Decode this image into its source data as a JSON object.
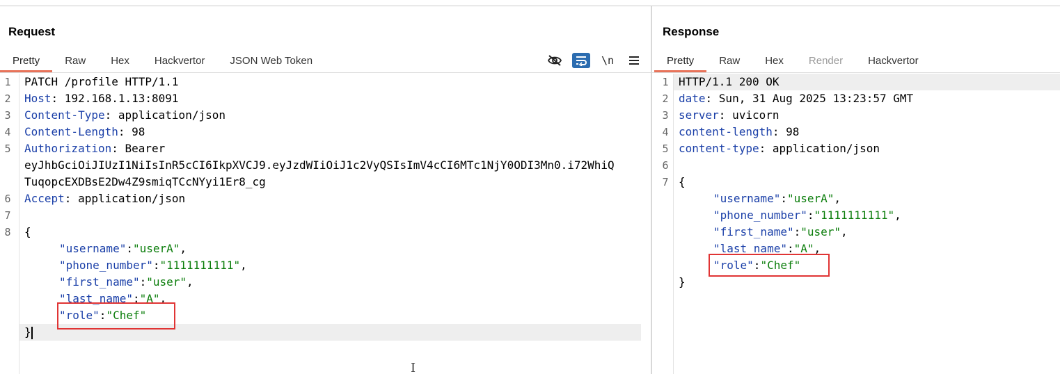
{
  "request": {
    "title": "Request",
    "tabs": [
      "Pretty",
      "Raw",
      "Hex",
      "Hackvertor",
      "JSON Web Token"
    ],
    "toolbar": {
      "hide_icon": "eye-off-icon",
      "wrap_icon": "wrap-lines-icon",
      "newline_label": "\\n",
      "menu_icon": "hamburger-menu-icon"
    },
    "lines": {
      "l1": "PATCH /profile HTTP/1.1",
      "l2k": "Host",
      "l2v": ": 192.168.1.13:8091",
      "l3k": "Content-Type",
      "l3v": ": application/json",
      "l4k": "Content-Length",
      "l4v": ": 98",
      "l5k": "Authorization",
      "l5v": ": Bearer",
      "l5w1": "eyJhbGciOiJIUzI1NiIsInR5cCI6IkpXVCJ9.eyJzdWIiOiJ1c2VyQSIsImV4cCI6MTc1NjY0ODI3Mn0.i72WhiQ",
      "l5w2": "TuqopcEXDBsE2Dw4Z9smiqTCcNYyi1Er8_cg",
      "l6k": "Accept",
      "l6v": ": application/json",
      "l8": "{",
      "f1k": "\"username\"",
      "f1v": "\"userA\"",
      "f2k": "\"phone_number\"",
      "f2v": "\"1111111111\"",
      "f3k": "\"first_name\"",
      "f3v": "\"user\"",
      "f4k": "\"last_name\"",
      "f4v": "\"A\"",
      "f5k": "\"role\"",
      "f5v": "\"Chef\"",
      "end": "}"
    },
    "line_numbers": [
      "1",
      "2",
      "3",
      "4",
      "5",
      "6",
      "7",
      "8"
    ]
  },
  "response": {
    "title": "Response",
    "tabs": [
      "Pretty",
      "Raw",
      "Hex",
      "Render",
      "Hackvertor"
    ],
    "lines": {
      "l1": "HTTP/1.1 200 OK",
      "l2k": "date",
      "l2v": ": Sun, 31 Aug 2025 13:23:57 GMT",
      "l3k": "server",
      "l3v": ": uvicorn",
      "l4k": "content-length",
      "l4v": ": 98",
      "l5k": "content-type",
      "l5v": ": application/json",
      "l7": "{",
      "f1k": "\"username\"",
      "f1v": "\"userA\"",
      "f2k": "\"phone_number\"",
      "f2v": "\"1111111111\"",
      "f3k": "\"first_name\"",
      "f3v": "\"user\"",
      "f4k": "\"last_name\"",
      "f4v": "\"A\"",
      "f5k": "\"role\"",
      "f5v": "\"Chef\"",
      "end": "}"
    },
    "line_numbers": [
      "1",
      "2",
      "3",
      "4",
      "5",
      "6",
      "7"
    ]
  },
  "punct": {
    "colon": ":",
    "comma": ","
  }
}
